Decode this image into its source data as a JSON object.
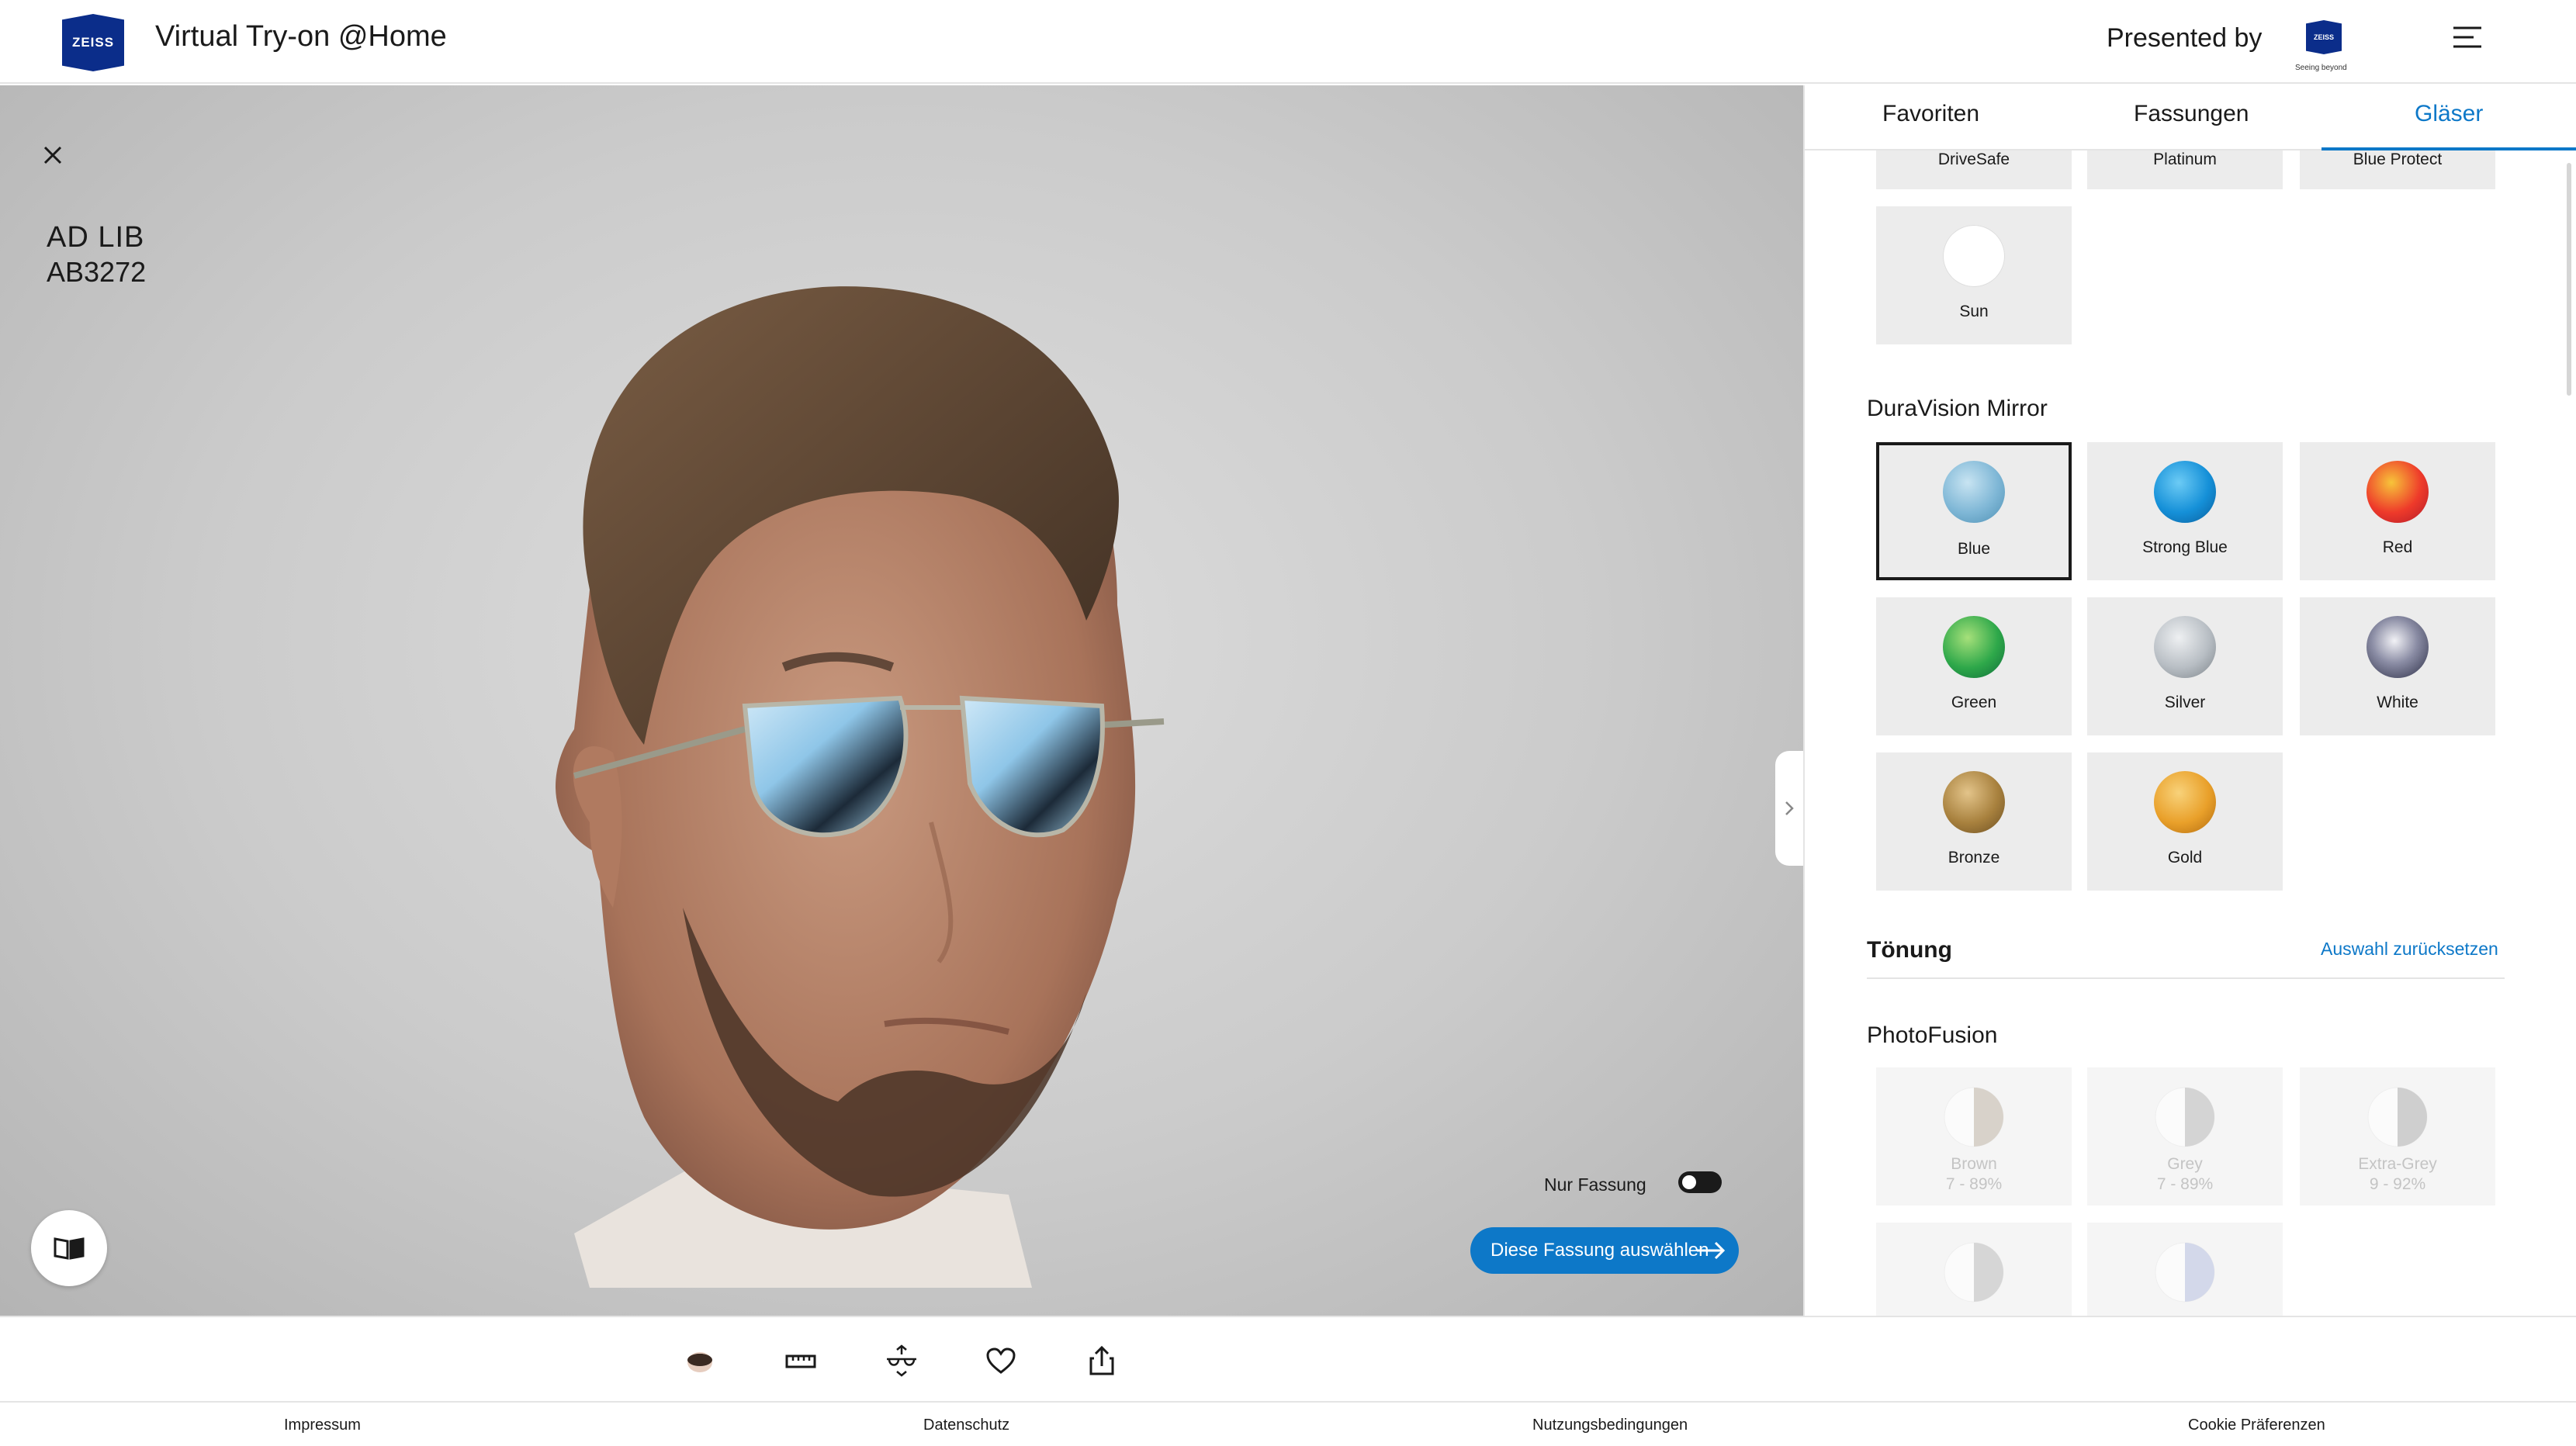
{
  "header": {
    "logo_text": "ZEISS",
    "title": "Virtual Try-on @Home",
    "presented_by": "Presented by",
    "presented_logo_text": "ZEISS",
    "presented_tagline": "Seeing beyond"
  },
  "viewer": {
    "frame_brand": "AD LIB",
    "frame_model": "AB3272",
    "toggle_label": "Nur Fassung",
    "select_button": "Diese Fassung auswählen"
  },
  "tabs": [
    {
      "label": "Favoriten"
    },
    {
      "label": "Fassungen"
    },
    {
      "label": "Gläser"
    }
  ],
  "lenses": {
    "top_partial": [
      {
        "name": "DriveSafe"
      },
      {
        "name": "Platinum"
      },
      {
        "name": "Blue Protect"
      }
    ],
    "sun": {
      "name": "Sun",
      "color": "#ffffff"
    },
    "mirror_title": "DuraVision Mirror",
    "mirror": [
      {
        "name": "Blue",
        "color": "#7fb7d6"
      },
      {
        "name": "Strong Blue",
        "color": "#1590d8"
      },
      {
        "name": "Red",
        "color": "#ee3a2a"
      },
      {
        "name": "Green",
        "color": "#2ea84a"
      },
      {
        "name": "Silver",
        "color": "#b8bec4"
      },
      {
        "name": "White",
        "color": "#5a5c72"
      },
      {
        "name": "Bronze",
        "color": "#a8813e"
      },
      {
        "name": "Gold",
        "color": "#e9a02a"
      }
    ],
    "tint_title": "Tönung",
    "reset_label": "Auswahl zurücksetzen",
    "photofusion_title": "PhotoFusion",
    "photofusion": [
      {
        "name": "Brown",
        "range": "7 - 89%"
      },
      {
        "name": "Grey",
        "range": "7 - 89%"
      },
      {
        "name": "Extra-Grey",
        "range": "9 - 92%"
      }
    ]
  },
  "footer": {
    "impressum": "Impressum",
    "datenschutz": "Datenschutz",
    "nutzungsbedingungen": "Nutzungsbedingungen",
    "cookie": "Cookie Präferenzen"
  }
}
